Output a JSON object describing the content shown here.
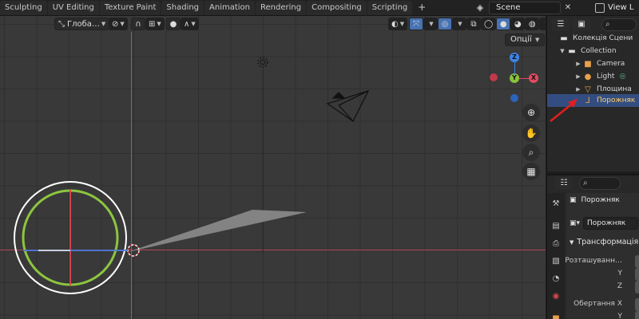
{
  "workspace_tabs": [
    "Sculpting",
    "UV Editing",
    "Texture Paint",
    "Shading",
    "Animation",
    "Rendering",
    "Compositing",
    "Scripting"
  ],
  "add_tab_label": "+",
  "scene": {
    "name": "Scene",
    "close": "✕"
  },
  "view_layer": {
    "label": "View L"
  },
  "viewport": {
    "header": {
      "orientation": "Глоба…",
      "options": "Опції"
    },
    "gizmo": {
      "z": "Z",
      "y": "Y",
      "x": "X"
    },
    "tools": [
      "zoom-icon",
      "hand-icon",
      "camera-icon",
      "grid-icon"
    ]
  },
  "outliner": {
    "search_icon": "⌕",
    "rows": [
      {
        "label": "Колекція Сцени",
        "icon": "collection-icon",
        "level": 0
      },
      {
        "label": "Collection",
        "icon": "collection-icon",
        "level": 1
      },
      {
        "label": "Camera",
        "icon": "camera-icon",
        "level": 2
      },
      {
        "label": "Light",
        "icon": "light-icon",
        "level": 2
      },
      {
        "label": "Площина",
        "icon": "mesh-icon",
        "level": 2
      },
      {
        "label": "Порожняк",
        "icon": "empty-icon",
        "level": 2,
        "selected": true
      }
    ]
  },
  "properties": {
    "object_name": "Порожняк",
    "field_value": "Порожняк",
    "section": "Трансформація",
    "labels": [
      "Розташуванн…",
      "Y",
      "Z",
      "Обертання X",
      "Y"
    ]
  },
  "colors": {
    "viewport_bg": "#393939",
    "x_axis": "#b5485a",
    "y_axis": "#4a72c8",
    "selected_row": "#334d80",
    "selected_text": "#ffcf6b",
    "arrow": "#e02020",
    "gizmo_x": "#e04a5f",
    "gizmo_y": "#8ac23a",
    "gizmo_z": "#3d84e6"
  }
}
